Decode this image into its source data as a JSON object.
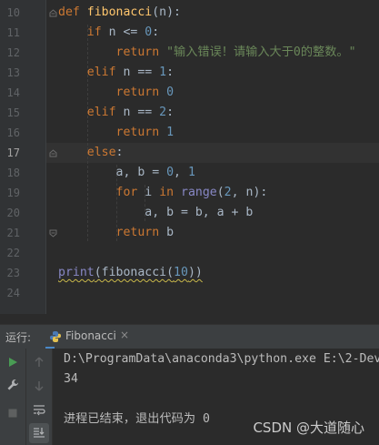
{
  "editor": {
    "line_numbers": [
      "10",
      "11",
      "12",
      "13",
      "14",
      "15",
      "16",
      "17",
      "18",
      "19",
      "20",
      "21",
      "22",
      "23",
      "24"
    ],
    "current_line": "17",
    "lines": [
      [
        {
          "t": "def ",
          "c": "kw"
        },
        {
          "t": "fibonacci",
          "c": "fn"
        },
        {
          "t": "(n):",
          "c": ""
        }
      ],
      [
        {
          "t": "    ",
          "c": ""
        },
        {
          "t": "if ",
          "c": "kw"
        },
        {
          "t": "n <= ",
          "c": ""
        },
        {
          "t": "0",
          "c": "num"
        },
        {
          "t": ":",
          "c": ""
        }
      ],
      [
        {
          "t": "        ",
          "c": ""
        },
        {
          "t": "return ",
          "c": "kw"
        },
        {
          "t": "\"输入错误！请输入大于0的整数。\"",
          "c": "str"
        }
      ],
      [
        {
          "t": "    ",
          "c": ""
        },
        {
          "t": "elif ",
          "c": "kw"
        },
        {
          "t": "n == ",
          "c": ""
        },
        {
          "t": "1",
          "c": "num"
        },
        {
          "t": ":",
          "c": ""
        }
      ],
      [
        {
          "t": "        ",
          "c": ""
        },
        {
          "t": "return ",
          "c": "kw"
        },
        {
          "t": "0",
          "c": "num"
        }
      ],
      [
        {
          "t": "    ",
          "c": ""
        },
        {
          "t": "elif ",
          "c": "kw"
        },
        {
          "t": "n == ",
          "c": ""
        },
        {
          "t": "2",
          "c": "num"
        },
        {
          "t": ":",
          "c": ""
        }
      ],
      [
        {
          "t": "        ",
          "c": ""
        },
        {
          "t": "return ",
          "c": "kw"
        },
        {
          "t": "1",
          "c": "num"
        }
      ],
      [
        {
          "t": "    ",
          "c": ""
        },
        {
          "t": "else",
          "c": "kw"
        },
        {
          "t": ":",
          "c": ""
        }
      ],
      [
        {
          "t": "        a, b = ",
          "c": ""
        },
        {
          "t": "0",
          "c": "num"
        },
        {
          "t": ", ",
          "c": ""
        },
        {
          "t": "1",
          "c": "num"
        }
      ],
      [
        {
          "t": "        ",
          "c": ""
        },
        {
          "t": "for ",
          "c": "kw"
        },
        {
          "t": "i ",
          "c": ""
        },
        {
          "t": "in ",
          "c": "kw"
        },
        {
          "t": "range",
          "c": "builtin"
        },
        {
          "t": "(",
          "c": ""
        },
        {
          "t": "2",
          "c": "num"
        },
        {
          "t": ", n):",
          "c": ""
        }
      ],
      [
        {
          "t": "            a, b = b, a + b",
          "c": ""
        }
      ],
      [
        {
          "t": "        ",
          "c": ""
        },
        {
          "t": "return ",
          "c": "kw"
        },
        {
          "t": "b",
          "c": ""
        }
      ],
      [],
      [
        {
          "t": "print",
          "c": "builtin squiggle"
        },
        {
          "t": "(fibonacci(",
          "c": "squiggle"
        },
        {
          "t": "10",
          "c": "num squiggle"
        },
        {
          "t": "))",
          "c": "squiggle"
        }
      ],
      []
    ]
  },
  "run_panel": {
    "label": "运行:",
    "tab_label": "Fibonacci",
    "tab_close": "×",
    "console": [
      "D:\\ProgramData\\anaconda3\\python.exe E:\\2-Dev",
      "34",
      "",
      "进程已结束，退出代码为 0"
    ]
  },
  "watermark": "CSDN @大道随心",
  "colors": {
    "editor_bg": "#2b2b2b",
    "gutter_bg": "#313335",
    "keyword": "#cc7832",
    "function": "#ffc66d",
    "number": "#6897bb",
    "string": "#6a8759",
    "builtin": "#8888c6",
    "run_green": "#499c54"
  }
}
